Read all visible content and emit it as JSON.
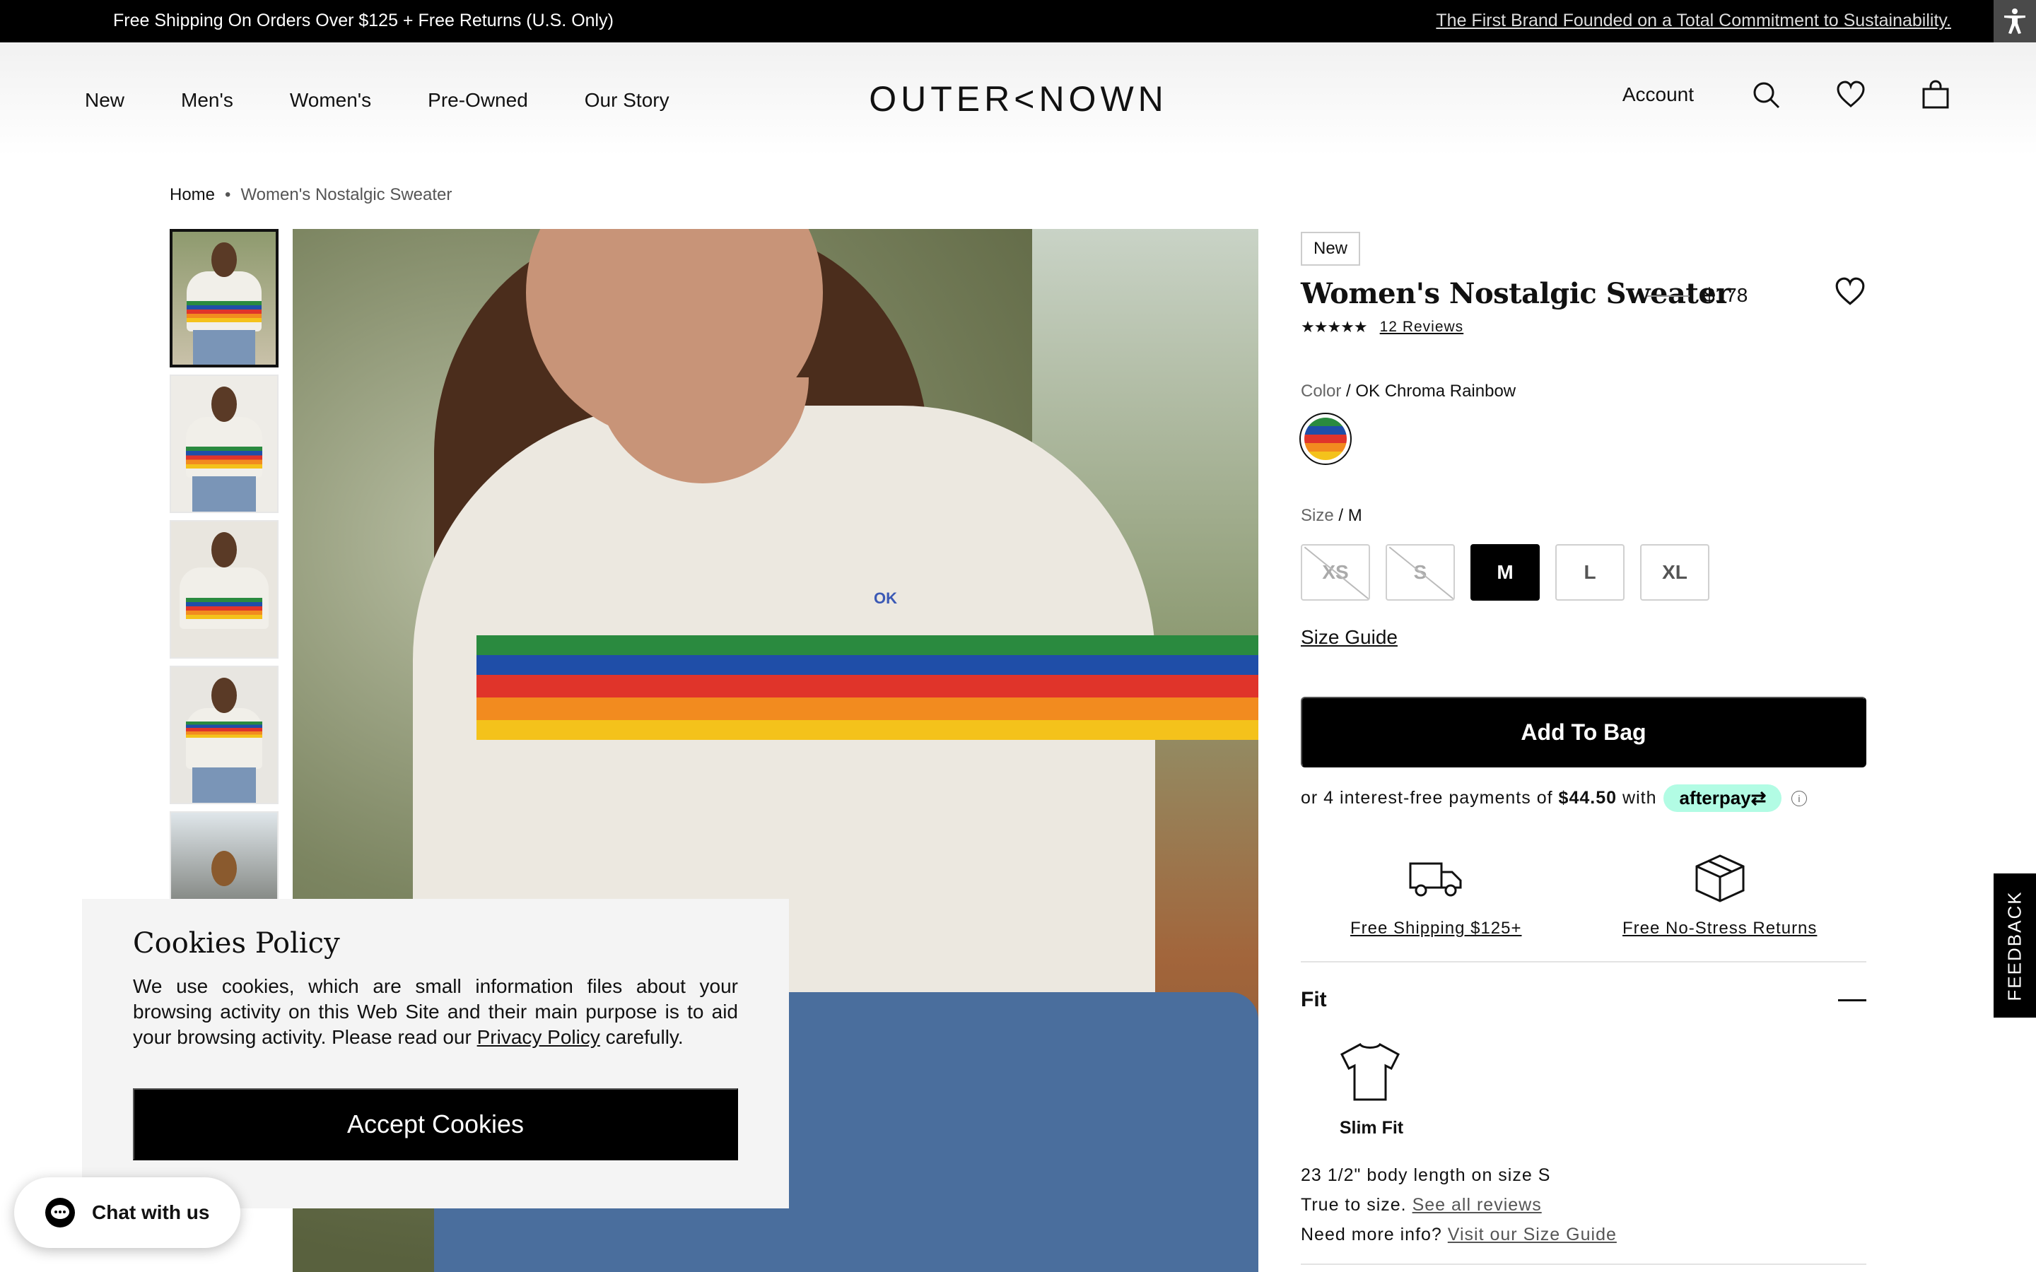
{
  "announcement": {
    "left": "Free Shipping On Orders Over $125 + Free Returns (U.S. Only)",
    "right": "The First Brand Founded on a Total Commitment to Sustainability."
  },
  "nav": {
    "items": [
      "New",
      "Men's",
      "Women's",
      "Pre-Owned",
      "Our Story"
    ],
    "logo": "OUTER<NOWN",
    "account": "Account"
  },
  "icons": {
    "accessibility": "accessibility-icon",
    "search": "search-icon",
    "wishlist": "heart-icon",
    "bag": "shopping-bag-icon",
    "truck": "truck-icon",
    "box": "box-icon",
    "tshirt": "tshirt-icon",
    "chat": "chat-icon"
  },
  "breadcrumb": {
    "home": "Home",
    "separator": "•",
    "current": "Women's Nostalgic Sweater"
  },
  "product": {
    "badge": "New",
    "title": "Women's Nostalgic Sweater",
    "price": "$178",
    "stars": "★★★★★",
    "rating": 5,
    "reviews": "12 Reviews",
    "color_key": "Color",
    "color_value": " / OK Chroma Rainbow",
    "size_key": "Size",
    "size_value": " / M",
    "sizes": [
      {
        "label": "XS",
        "available": false,
        "selected": false
      },
      {
        "label": "S",
        "available": false,
        "selected": false
      },
      {
        "label": "M",
        "available": true,
        "selected": true
      },
      {
        "label": "L",
        "available": true,
        "selected": false
      },
      {
        "label": "XL",
        "available": true,
        "selected": false
      }
    ],
    "size_guide": "Size Guide",
    "add_to_bag": "Add To Bag",
    "afterpay_prefix": "or 4 interest-free payments of",
    "afterpay_amount": "$44.50",
    "afterpay_with": "with",
    "afterpay_brand": "afterpay⇄",
    "afterpay_info": "i",
    "perk_shipping": "Free Shipping $125+",
    "perk_returns": "Free No-Stress Returns",
    "fit_title": "Fit",
    "fit_type": "Slim Fit",
    "fit_length": "23 1/2\" body length on size S",
    "true_to_size": "True to size.",
    "see_reviews": "See all reviews",
    "more_info": "Need more info?",
    "visit_guide": "Visit our Size Guide",
    "image_brand_mark": "OK"
  },
  "cookies": {
    "title": "Cookies Policy",
    "text_before": "We use cookies, which are small information files about your browsing activity on this Web Site and their main purpose is to aid your browsing activity. Please read our ",
    "link": "Privacy Policy",
    "text_after": " carefully.",
    "accept": "Accept Cookies"
  },
  "chat": {
    "label": "Chat with us"
  },
  "feedback": {
    "label": "FEEDBACK"
  },
  "colors": {
    "black": "#000000",
    "afterpay": "#b2fce4",
    "rainbow": [
      "#2a8a3f",
      "#1f4ea8",
      "#e0342a",
      "#f28b1f",
      "#f4c21b"
    ]
  }
}
